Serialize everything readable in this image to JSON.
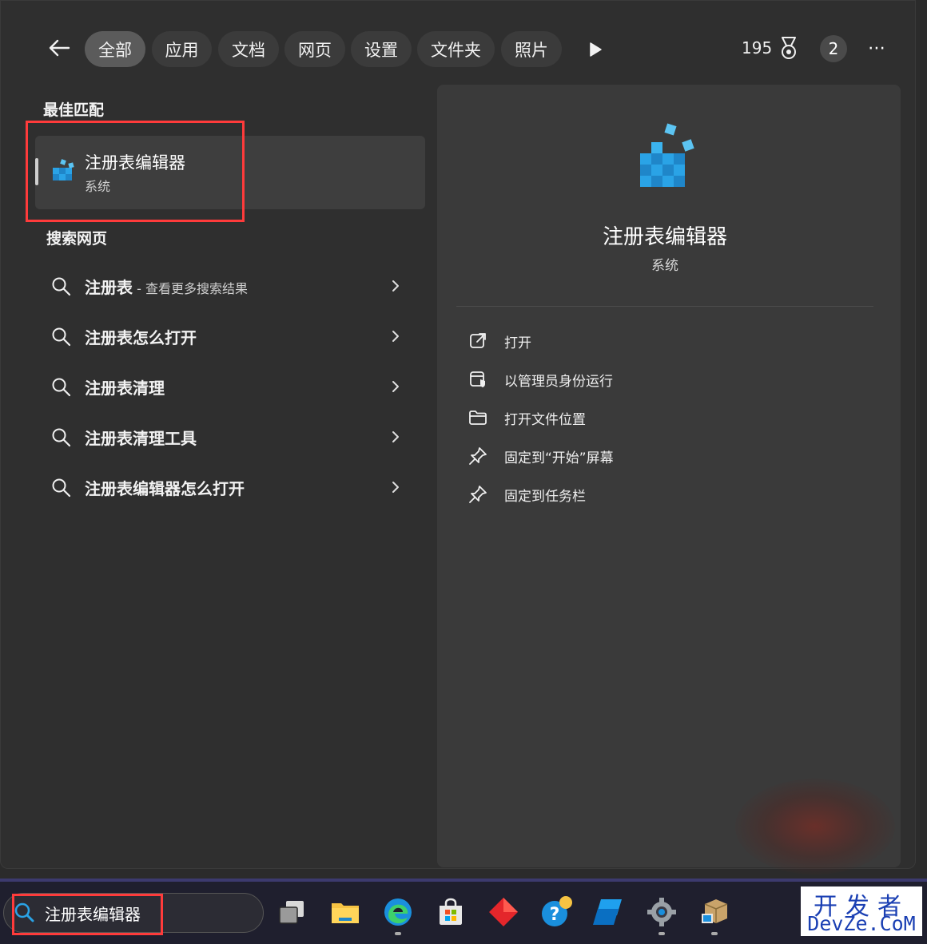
{
  "header": {
    "tabs": [
      {
        "label": "全部",
        "active": true
      },
      {
        "label": "应用"
      },
      {
        "label": "文档"
      },
      {
        "label": "网页"
      },
      {
        "label": "设置"
      },
      {
        "label": "文件夹"
      },
      {
        "label": "照片"
      }
    ],
    "points": "195",
    "avatar_initial": "2",
    "more": "⋯"
  },
  "best_match": {
    "heading": "最佳匹配",
    "name": "注册表编辑器",
    "type": "系统"
  },
  "web_search": {
    "heading": "搜索网页",
    "items": [
      {
        "text": "注册表",
        "hint": " - 查看更多搜索结果"
      },
      {
        "text": "注册表怎么打开",
        "hint": ""
      },
      {
        "text": "注册表清理",
        "hint": ""
      },
      {
        "text": "注册表清理工具",
        "hint": ""
      },
      {
        "text": "注册表编辑器怎么打开",
        "hint": ""
      }
    ]
  },
  "detail": {
    "title": "注册表编辑器",
    "subtitle": "系统",
    "actions": [
      {
        "label": "打开",
        "icon": "open-external-icon"
      },
      {
        "label": "以管理员身份运行",
        "icon": "run-as-admin-icon"
      },
      {
        "label": "打开文件位置",
        "icon": "folder-icon"
      },
      {
        "label": "固定到“开始”屏幕",
        "icon": "pin-icon"
      },
      {
        "label": "固定到任务栏",
        "icon": "pin-icon"
      }
    ]
  },
  "taskbar": {
    "search_value": "注册表编辑器",
    "apps": [
      "task-view-icon",
      "file-explorer-icon",
      "edge-icon",
      "store-icon",
      "red-diamond-app-icon",
      "help-icon",
      "blue-windows-app-icon",
      "settings-icon",
      "installer-icon"
    ]
  },
  "watermark": {
    "cn": "开发者",
    "en": "DevZe.CoM"
  },
  "colors": {
    "highlight_box": "#ff3b3b",
    "registry_blue": "#2aa3e6",
    "watermark": "#1a3fb3"
  }
}
